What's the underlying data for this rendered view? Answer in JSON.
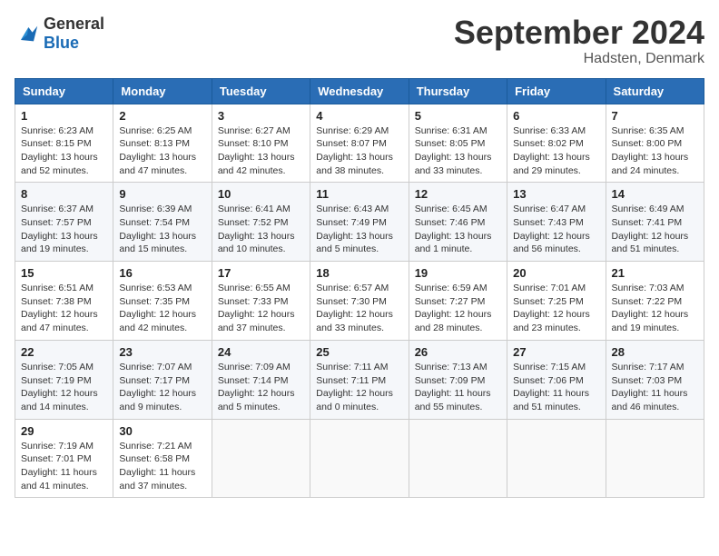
{
  "header": {
    "logo_line1": "General",
    "logo_line2": "Blue",
    "month_year": "September 2024",
    "location": "Hadsten, Denmark"
  },
  "days_of_week": [
    "Sunday",
    "Monday",
    "Tuesday",
    "Wednesday",
    "Thursday",
    "Friday",
    "Saturday"
  ],
  "weeks": [
    [
      {
        "day": "1",
        "info": "Sunrise: 6:23 AM\nSunset: 8:15 PM\nDaylight: 13 hours\nand 52 minutes."
      },
      {
        "day": "2",
        "info": "Sunrise: 6:25 AM\nSunset: 8:13 PM\nDaylight: 13 hours\nand 47 minutes."
      },
      {
        "day": "3",
        "info": "Sunrise: 6:27 AM\nSunset: 8:10 PM\nDaylight: 13 hours\nand 42 minutes."
      },
      {
        "day": "4",
        "info": "Sunrise: 6:29 AM\nSunset: 8:07 PM\nDaylight: 13 hours\nand 38 minutes."
      },
      {
        "day": "5",
        "info": "Sunrise: 6:31 AM\nSunset: 8:05 PM\nDaylight: 13 hours\nand 33 minutes."
      },
      {
        "day": "6",
        "info": "Sunrise: 6:33 AM\nSunset: 8:02 PM\nDaylight: 13 hours\nand 29 minutes."
      },
      {
        "day": "7",
        "info": "Sunrise: 6:35 AM\nSunset: 8:00 PM\nDaylight: 13 hours\nand 24 minutes."
      }
    ],
    [
      {
        "day": "8",
        "info": "Sunrise: 6:37 AM\nSunset: 7:57 PM\nDaylight: 13 hours\nand 19 minutes."
      },
      {
        "day": "9",
        "info": "Sunrise: 6:39 AM\nSunset: 7:54 PM\nDaylight: 13 hours\nand 15 minutes."
      },
      {
        "day": "10",
        "info": "Sunrise: 6:41 AM\nSunset: 7:52 PM\nDaylight: 13 hours\nand 10 minutes."
      },
      {
        "day": "11",
        "info": "Sunrise: 6:43 AM\nSunset: 7:49 PM\nDaylight: 13 hours\nand 5 minutes."
      },
      {
        "day": "12",
        "info": "Sunrise: 6:45 AM\nSunset: 7:46 PM\nDaylight: 13 hours\nand 1 minute."
      },
      {
        "day": "13",
        "info": "Sunrise: 6:47 AM\nSunset: 7:43 PM\nDaylight: 12 hours\nand 56 minutes."
      },
      {
        "day": "14",
        "info": "Sunrise: 6:49 AM\nSunset: 7:41 PM\nDaylight: 12 hours\nand 51 minutes."
      }
    ],
    [
      {
        "day": "15",
        "info": "Sunrise: 6:51 AM\nSunset: 7:38 PM\nDaylight: 12 hours\nand 47 minutes."
      },
      {
        "day": "16",
        "info": "Sunrise: 6:53 AM\nSunset: 7:35 PM\nDaylight: 12 hours\nand 42 minutes."
      },
      {
        "day": "17",
        "info": "Sunrise: 6:55 AM\nSunset: 7:33 PM\nDaylight: 12 hours\nand 37 minutes."
      },
      {
        "day": "18",
        "info": "Sunrise: 6:57 AM\nSunset: 7:30 PM\nDaylight: 12 hours\nand 33 minutes."
      },
      {
        "day": "19",
        "info": "Sunrise: 6:59 AM\nSunset: 7:27 PM\nDaylight: 12 hours\nand 28 minutes."
      },
      {
        "day": "20",
        "info": "Sunrise: 7:01 AM\nSunset: 7:25 PM\nDaylight: 12 hours\nand 23 minutes."
      },
      {
        "day": "21",
        "info": "Sunrise: 7:03 AM\nSunset: 7:22 PM\nDaylight: 12 hours\nand 19 minutes."
      }
    ],
    [
      {
        "day": "22",
        "info": "Sunrise: 7:05 AM\nSunset: 7:19 PM\nDaylight: 12 hours\nand 14 minutes."
      },
      {
        "day": "23",
        "info": "Sunrise: 7:07 AM\nSunset: 7:17 PM\nDaylight: 12 hours\nand 9 minutes."
      },
      {
        "day": "24",
        "info": "Sunrise: 7:09 AM\nSunset: 7:14 PM\nDaylight: 12 hours\nand 5 minutes."
      },
      {
        "day": "25",
        "info": "Sunrise: 7:11 AM\nSunset: 7:11 PM\nDaylight: 12 hours\nand 0 minutes."
      },
      {
        "day": "26",
        "info": "Sunrise: 7:13 AM\nSunset: 7:09 PM\nDaylight: 11 hours\nand 55 minutes."
      },
      {
        "day": "27",
        "info": "Sunrise: 7:15 AM\nSunset: 7:06 PM\nDaylight: 11 hours\nand 51 minutes."
      },
      {
        "day": "28",
        "info": "Sunrise: 7:17 AM\nSunset: 7:03 PM\nDaylight: 11 hours\nand 46 minutes."
      }
    ],
    [
      {
        "day": "29",
        "info": "Sunrise: 7:19 AM\nSunset: 7:01 PM\nDaylight: 11 hours\nand 41 minutes."
      },
      {
        "day": "30",
        "info": "Sunrise: 7:21 AM\nSunset: 6:58 PM\nDaylight: 11 hours\nand 37 minutes."
      },
      null,
      null,
      null,
      null,
      null
    ]
  ]
}
